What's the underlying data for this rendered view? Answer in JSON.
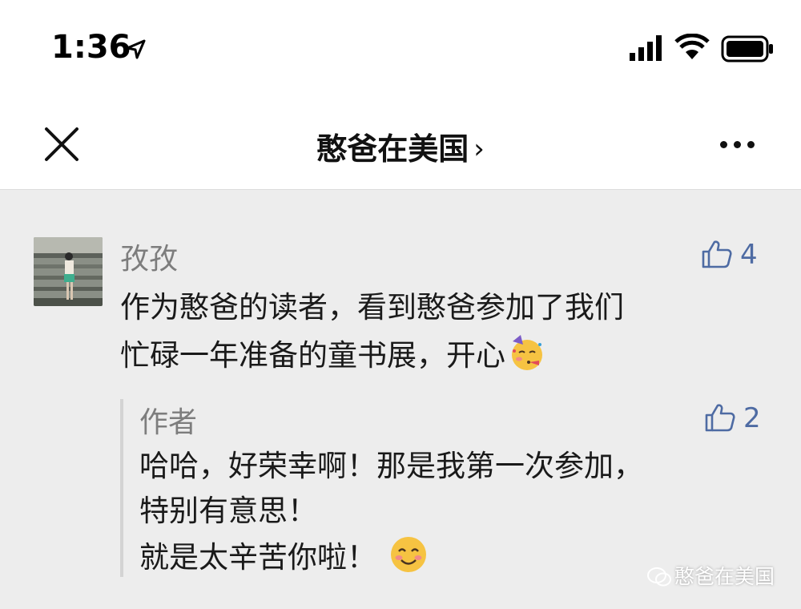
{
  "status_bar": {
    "time": "1:36"
  },
  "nav": {
    "title": "憨爸在美国",
    "chevron": "›"
  },
  "comment": {
    "author": "孜孜",
    "likes": "4",
    "text_line1": "作为憨爸的读者，看到憨爸参加了我们",
    "text_line2": "忙碌一年准备的童书展，开心",
    "emoji": "partying-face"
  },
  "reply": {
    "author": "作者",
    "likes": "2",
    "line1": "哈哈，好荣幸啊！那是我第一次参加，",
    "line2": "特别有意思！",
    "line3": "就是太辛苦你啦！",
    "emoji": "smiling-face"
  },
  "watermark": "憨爸在美国",
  "colors": {
    "like_blue": "#4e6ba3",
    "name_gray": "#7d7d7d",
    "background": "#ededed"
  }
}
